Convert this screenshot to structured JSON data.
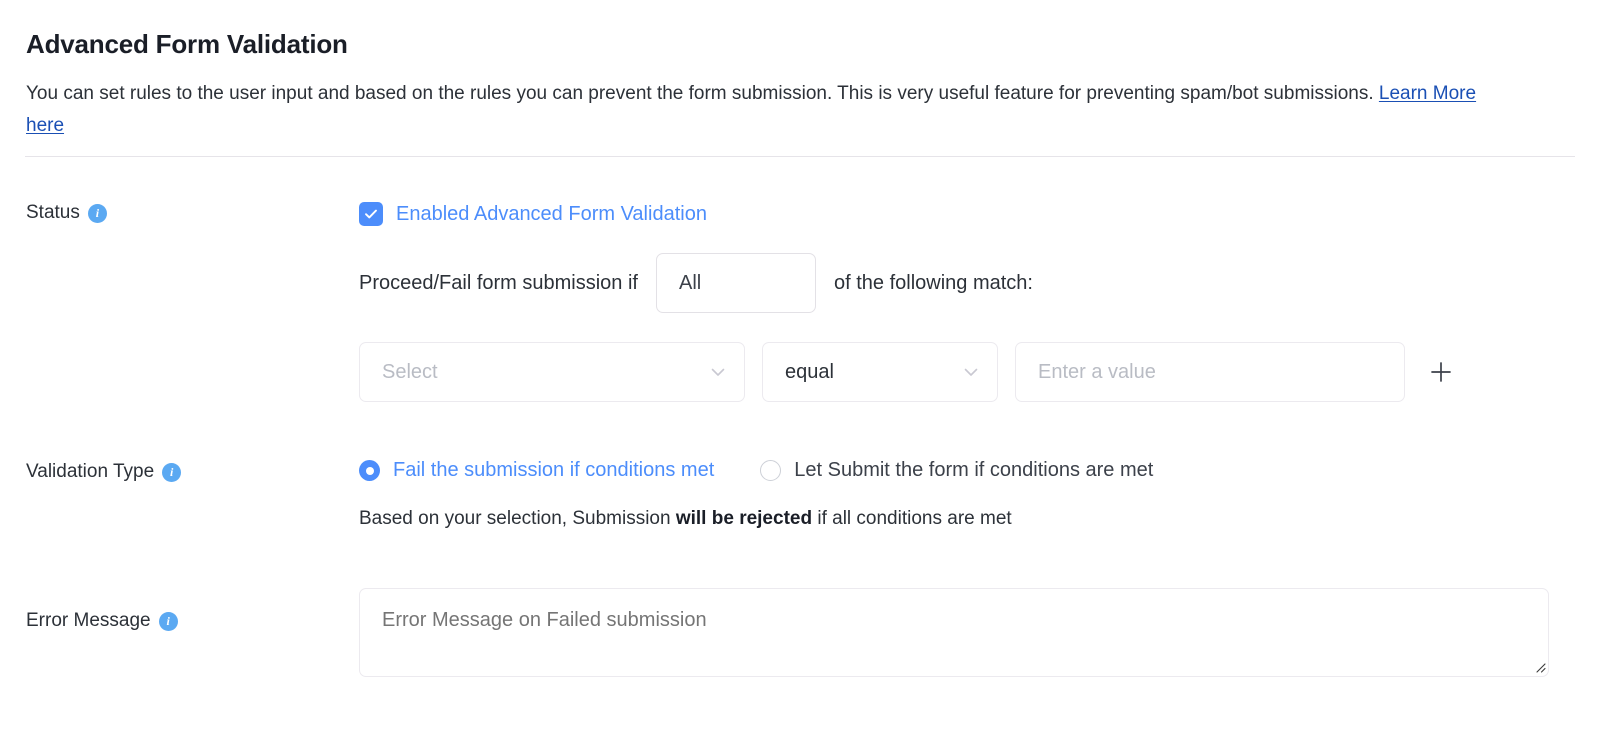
{
  "panel": {
    "title": "Advanced Form Validation",
    "description_part1": "You can set rules to the user input and based on the rules you can prevent the form submission. This is very useful feature for preventing spam/bot submissions. ",
    "learn_more_label": "Learn More here"
  },
  "status": {
    "label": "Status",
    "info_icon": "info-icon",
    "checkbox_checked": true,
    "checkbox_label": "Enabled Advanced Form Validation",
    "match_prefix": "Proceed/Fail form submission if",
    "match_selected": "All",
    "match_suffix": "of the following match:"
  },
  "condition": {
    "field_placeholder": "Select",
    "operator_value": "equal",
    "value_placeholder": "Enter a value",
    "add_button": "+",
    "chevron_icon": "chevron-down-icon",
    "add_icon": "plus-icon"
  },
  "validation_type": {
    "label": "Validation Type",
    "info_icon": "info-icon",
    "options": [
      {
        "label": "Fail the submission if conditions met",
        "selected": true
      },
      {
        "label": "Let Submit the form if conditions are met",
        "selected": false
      }
    ],
    "note_prefix": "Based on your selection, Submission ",
    "note_bold": "will be rejected",
    "note_suffix": " if all conditions are met"
  },
  "error_message": {
    "label": "Error Message",
    "info_icon": "info-icon",
    "placeholder": "Error Message on Failed submission",
    "value": ""
  },
  "colors": {
    "accent": "#4c8dfb",
    "link": "#1a4fb4",
    "info_badge": "#5ba9f2",
    "text": "#2c3138",
    "placeholder": "#b9bcc4",
    "border": "#eceaef"
  }
}
